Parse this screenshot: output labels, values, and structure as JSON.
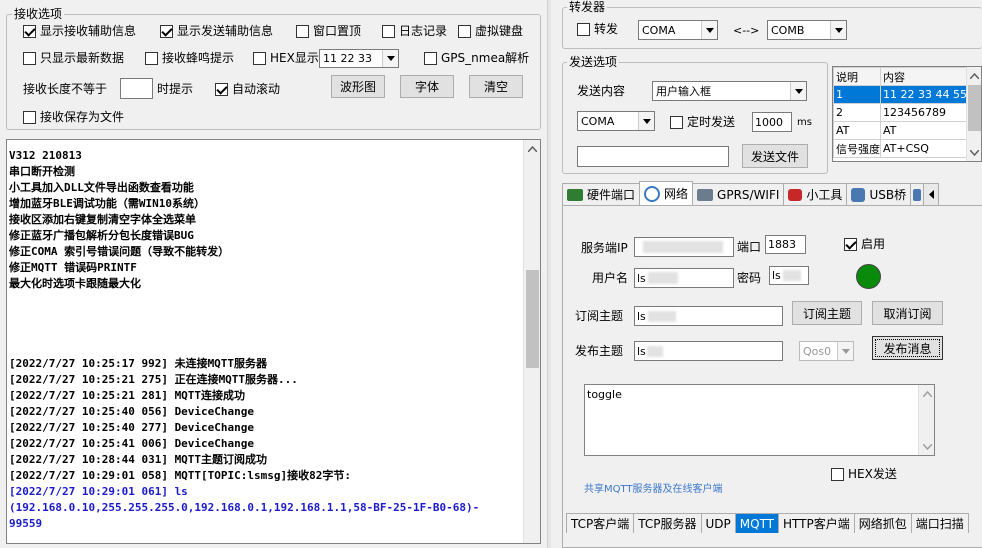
{
  "receive": {
    "legend": "接收选项",
    "show_rx_info": "显示接收辅助信息",
    "show_tx_info": "显示发送辅助信息",
    "window_top": "窗口置顶",
    "log_record": "日志记录",
    "virtual_keyboard": "虚拟键盘",
    "show_latest_only": "只显示最新数据",
    "rx_beep": "接收蜂鸣提示",
    "hex_show": "HEX显示",
    "hex_example": "11 22 33",
    "gps_parse": "GPS_nmea解析",
    "rx_len_label": "接收长度不等于",
    "rx_len_value": "",
    "tip_label": "时提示",
    "auto_scroll": "自动滚动",
    "waveform_btn": "波形图",
    "font_btn": "字体",
    "clear_btn": "清空",
    "save_to_file": "接收保存为文件"
  },
  "log": {
    "lines": [
      {
        "text": "V312 210813",
        "color": "#000000"
      },
      {
        "text": "串口断开检测",
        "color": "#000000"
      },
      {
        "text": "小工具加入DLL文件导出函数查看功能",
        "color": "#000000"
      },
      {
        "text": "增加蓝牙BLE调试功能（需WIN10系统）",
        "color": "#000000"
      },
      {
        "text": "接收区添加右键复制清空字体全选菜单",
        "color": "#000000"
      },
      {
        "text": "修正蓝牙广播包解析分包长度错误BUG",
        "color": "#000000"
      },
      {
        "text": "修正COMA 索引号错误问题（导致不能转发）",
        "color": "#000000"
      },
      {
        "text": "修正MQTT 错误码PRINTF",
        "color": "#000000"
      },
      {
        "text": "最大化时选项卡跟随最大化",
        "color": "#000000"
      },
      {
        "text": "",
        "color": "#000000"
      },
      {
        "text": "",
        "color": "#000000"
      },
      {
        "text": "",
        "color": "#000000"
      },
      {
        "text": "",
        "color": "#000000"
      },
      {
        "text": "[2022/7/27 10:25:17 992]  未连接MQTT服务器",
        "color": "#000000"
      },
      {
        "text": "[2022/7/27 10:25:21 275]  正在连接MQTT服务器...",
        "color": "#000000"
      },
      {
        "text": "[2022/7/27 10:25:21 281]  MQTT连接成功",
        "color": "#000000"
      },
      {
        "text": "[2022/7/27 10:25:40 056]  DeviceChange",
        "color": "#000000"
      },
      {
        "text": "[2022/7/27 10:25:40 277]  DeviceChange",
        "color": "#000000"
      },
      {
        "text": "[2022/7/27 10:25:41 006]  DeviceChange",
        "color": "#000000"
      },
      {
        "text": "[2022/7/27 10:28:44 031]  MQTT主题订阅成功",
        "color": "#000000"
      },
      {
        "text": "[2022/7/27 10:29:01 058]  MQTT[TOPIC:lsmsg]接收82字节:",
        "color": "#000000"
      },
      {
        "text": "[2022/7/27 10:29:01 061]  ls",
        "color": "#1a1acc"
      },
      {
        "text": "(192.168.0.10,255.255.255.0,192.168.0.1,192.168.1.1,58-BF-25-1F-B0-68)-",
        "color": "#1a1acc"
      },
      {
        "text": "99559",
        "color": "#1a1acc"
      }
    ]
  },
  "forward": {
    "legend": "转发器",
    "forward_label": "转发",
    "left_port": "COMA",
    "arrow": "<-->",
    "right_port": "COMB"
  },
  "send": {
    "legend": "发送选项",
    "content_label": "发送内容",
    "content_mode": "用户输入框",
    "port": "COMA",
    "timer_label": "定时发送",
    "timer_value": "1000",
    "timer_unit": "ms",
    "file_input": "",
    "send_file_btn": "发送文件"
  },
  "cmd_table": {
    "headers": [
      "说明",
      "内容"
    ],
    "rows": [
      [
        "1",
        "11 22 33 44 55"
      ],
      [
        "2",
        "123456789"
      ],
      [
        "AT",
        "AT"
      ],
      [
        "信号强度",
        "AT+CSQ"
      ],
      [
        "",
        ""
      ]
    ]
  },
  "top_tabs": [
    {
      "label": "硬件端口",
      "icon": "hardware-icon"
    },
    {
      "label": "网络",
      "icon": "network-icon"
    },
    {
      "label": "GPRS/WIFI",
      "icon": "wifi-icon"
    },
    {
      "label": "小工具",
      "icon": "tools-icon"
    },
    {
      "label": "USB桥",
      "icon": "usb-icon"
    }
  ],
  "mqtt": {
    "server_ip_label": "服务端IP",
    "server_ip": "",
    "port_label": "端口",
    "port": "1883",
    "enable_label": "启用",
    "username_label": "用户名",
    "username": "ls",
    "password_label": "密码",
    "password": "ls",
    "status_color": "#0a8a0a",
    "sub_topic_label": "订阅主题",
    "sub_topic": "ls",
    "subscribe_btn": "订阅主题",
    "unsubscribe_btn": "取消订阅",
    "pub_topic_label": "发布主题",
    "pub_topic": "ls",
    "qos": "Qos0",
    "publish_btn": "发布消息",
    "message": "toggle",
    "hex_send": "HEX发送",
    "shared_link": "共享MQTT服务器及在线客户端"
  },
  "bottom_tabs": [
    "TCP客户端",
    "TCP服务器",
    "UDP",
    "MQTT",
    "HTTP客户端",
    "网络抓包",
    "端口扫描"
  ]
}
